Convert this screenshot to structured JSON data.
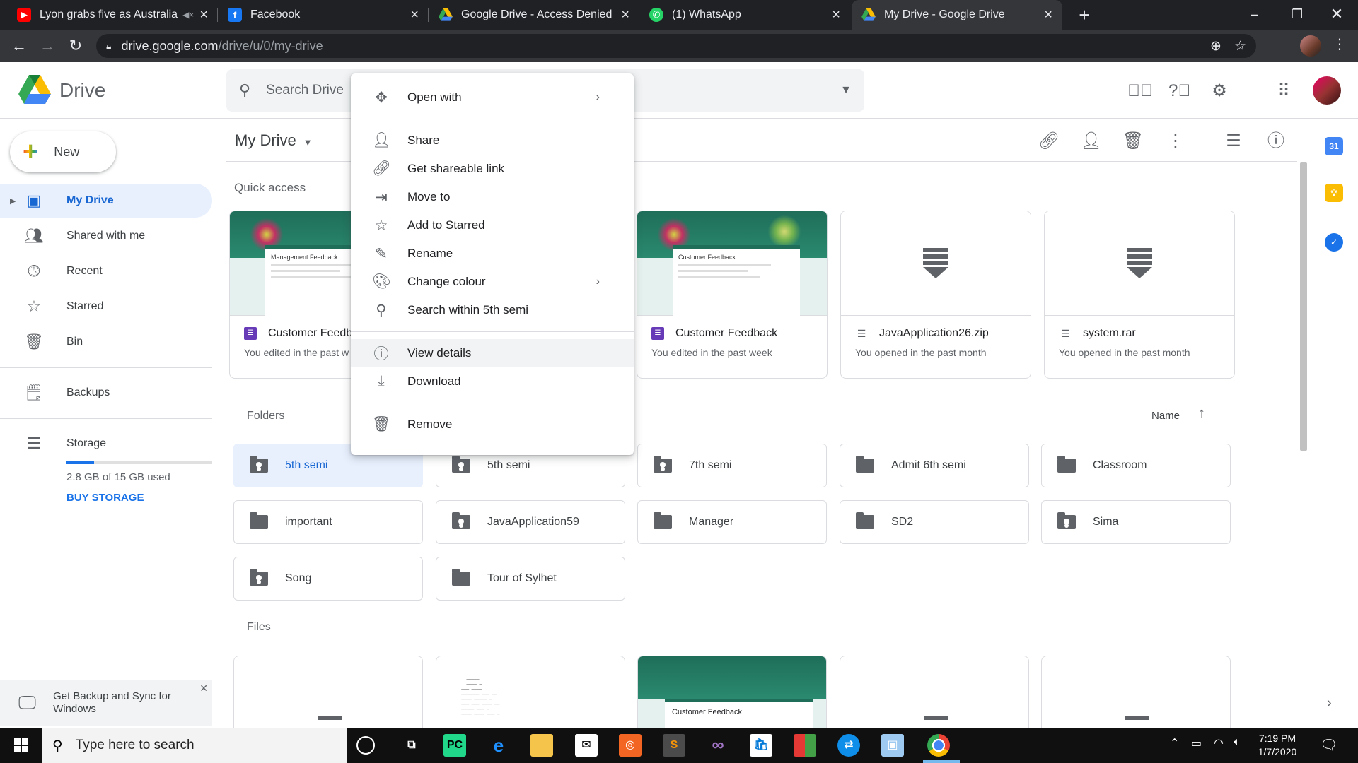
{
  "browser": {
    "tabs": [
      {
        "title": "Lyon grabs five as Australia c",
        "favicon": "youtube-icon",
        "color": "#ff0000"
      },
      {
        "title": "Facebook",
        "favicon": "facebook-icon",
        "color": "#1877f2"
      },
      {
        "title": "Google Drive - Access Denied",
        "favicon": "drive-icon",
        "color": "#fbbc04"
      },
      {
        "title": "(1) WhatsApp",
        "favicon": "whatsapp-icon",
        "color": "#25d366"
      },
      {
        "title": "My Drive - Google Drive",
        "favicon": "drive-icon",
        "color": "#fbbc04",
        "active": true
      }
    ],
    "url_host": "drive.google.com",
    "url_path": "/drive/u/0/my-drive"
  },
  "header": {
    "brand": "Drive",
    "search_placeholder": "Search Drive"
  },
  "sidebar": {
    "new_label": "New",
    "items": [
      {
        "label": "My Drive",
        "icon": "my-drive-icon",
        "active": true
      },
      {
        "label": "Shared with me",
        "icon": "shared-icon"
      },
      {
        "label": "Recent",
        "icon": "clock-icon"
      },
      {
        "label": "Starred",
        "icon": "star-icon"
      },
      {
        "label": "Bin",
        "icon": "trash-icon"
      },
      {
        "label": "Backups",
        "icon": "backup-icon"
      },
      {
        "label": "Storage",
        "icon": "storage-icon"
      }
    ],
    "storage_used_fraction": 0.187,
    "storage_text": "2.8 GB of 15 GB used",
    "buy_storage": "BUY STORAGE",
    "backup_sync": "Get Backup and Sync for Windows"
  },
  "main": {
    "title": "My Drive",
    "quick_access_title": "Quick access",
    "quick_access": [
      {
        "name": "Customer Feedb",
        "sub": "You edited in the past w",
        "kind": "form",
        "form_title": "Management Feedback"
      },
      {
        "name": "Customer Feedback",
        "sub": "You edited in the past week",
        "kind": "form",
        "form_title": "Customer Feedback"
      },
      {
        "name": "JavaApplication26.zip",
        "sub": "You opened in the past month",
        "kind": "archive"
      },
      {
        "name": "system.rar",
        "sub": "You opened in the past month",
        "kind": "archive"
      }
    ],
    "folders_title": "Folders",
    "sort_label": "Name",
    "folders": [
      {
        "name": "5th semi",
        "shared": true,
        "selected": true
      },
      {
        "name": "5th semi",
        "shared": true
      },
      {
        "name": "7th semi",
        "shared": true
      },
      {
        "name": "Admit 6th semi",
        "shared": false
      },
      {
        "name": "Classroom",
        "shared": false
      },
      {
        "name": "important",
        "shared": false
      },
      {
        "name": "JavaApplication59",
        "shared": true
      },
      {
        "name": "Manager",
        "shared": false
      },
      {
        "name": "SD2",
        "shared": false
      },
      {
        "name": "Sima",
        "shared": true
      },
      {
        "name": "Song",
        "shared": true
      },
      {
        "name": "Tour of Sylhet",
        "shared": false
      }
    ],
    "files_title": "Files",
    "file_preview_form_title": "Customer Feedback"
  },
  "context_menu": {
    "items": [
      {
        "label": "Open with",
        "icon": "move-arrows-icon",
        "submenu": true
      },
      {
        "sep": true
      },
      {
        "label": "Share",
        "icon": "person-add-icon"
      },
      {
        "label": "Get shareable link",
        "icon": "link-icon"
      },
      {
        "label": "Move to",
        "icon": "move-to-folder-icon"
      },
      {
        "label": "Add to Starred",
        "icon": "star-outline-icon"
      },
      {
        "label": "Rename",
        "icon": "pencil-icon"
      },
      {
        "label": "Change colour",
        "icon": "palette-icon",
        "submenu": true
      },
      {
        "label": "Search within 5th semi",
        "icon": "search-icon"
      },
      {
        "sep": true
      },
      {
        "label": "View details",
        "icon": "info-icon",
        "highlighted": true
      },
      {
        "label": "Download",
        "icon": "download-icon"
      },
      {
        "sep": true
      },
      {
        "label": "Remove",
        "icon": "trash-icon"
      }
    ]
  },
  "taskbar": {
    "search_placeholder": "Type here to search",
    "time": "7:19 PM",
    "date": "1/7/2020"
  }
}
